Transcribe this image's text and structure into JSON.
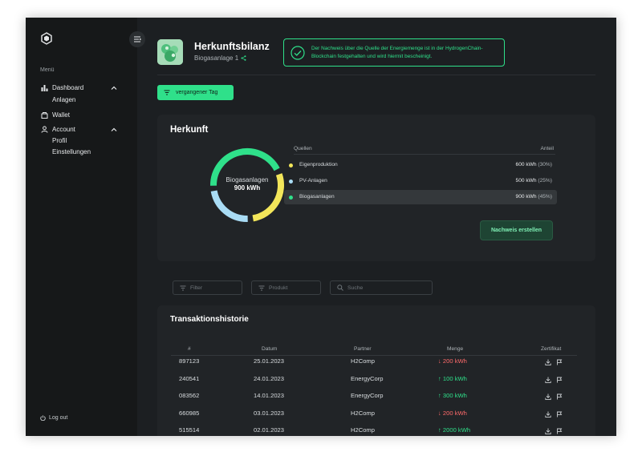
{
  "sidebar": {
    "menu_label": "Menü",
    "items": [
      {
        "label": "Dashboard",
        "icon": "bar-chart-icon",
        "children": [
          "Anlagen"
        ]
      },
      {
        "label": "Wallet",
        "icon": "wallet-icon",
        "children": []
      },
      {
        "label": "Account",
        "icon": "user-icon",
        "children": [
          "Profil",
          "Einstellungen"
        ]
      }
    ],
    "logout_label": "Log out"
  },
  "header": {
    "title": "Herkunftsbilanz",
    "subtitle": "Biogasanlage 1",
    "notice": "Der Nachweis über die Quelle der Energiemenge ist in der HydrogenChain-Blockchain festgehalten und wird hiermit bescheinigt."
  },
  "filter_button": "vergangener Tag",
  "herkunft": {
    "title": "Herkunft",
    "center_label": "Biogasanlagen",
    "center_value": "900 kWh",
    "col_sources": "Quellen",
    "col_share": "Anteil",
    "sources": [
      {
        "name": "Eigenproduktion",
        "value": "600 kWh",
        "pct": "(30%)",
        "share": 0.3,
        "color": "#f3e65a"
      },
      {
        "name": "PV-Anlagen",
        "value": "500 kWh",
        "pct": "(25%)",
        "share": 0.25,
        "color": "#a9dcf5"
      },
      {
        "name": "Biogasanlagen",
        "value": "900 kWh",
        "pct": "(45%)",
        "share": 0.45,
        "color": "#2fe08a"
      }
    ],
    "button": "Nachweis erstellen"
  },
  "search": {
    "filter_placeholder": "Filter",
    "produkt_placeholder": "Produkt",
    "suche_placeholder": "Suche"
  },
  "transactions": {
    "title": "Transaktionshistorie",
    "headers": [
      "#",
      "Datum",
      "Partner",
      "Menge",
      "Zertifikat"
    ],
    "rows": [
      {
        "id": "897123",
        "date": "25.01.2023",
        "partner": "H2Comp",
        "dir": "down",
        "amount": "200 kWh"
      },
      {
        "id": "240541",
        "date": "24.01.2023",
        "partner": "EnergyCorp",
        "dir": "up",
        "amount": "100 kWh"
      },
      {
        "id": "083562",
        "date": "14.01.2023",
        "partner": "EnergyCorp",
        "dir": "up",
        "amount": "300 kWh"
      },
      {
        "id": "660985",
        "date": "03.01.2023",
        "partner": "H2Comp",
        "dir": "down",
        "amount": "200 kWh"
      },
      {
        "id": "515514",
        "date": "02.01.2023",
        "partner": "H2Comp",
        "dir": "up",
        "amount": "2000 kWh"
      }
    ]
  }
}
